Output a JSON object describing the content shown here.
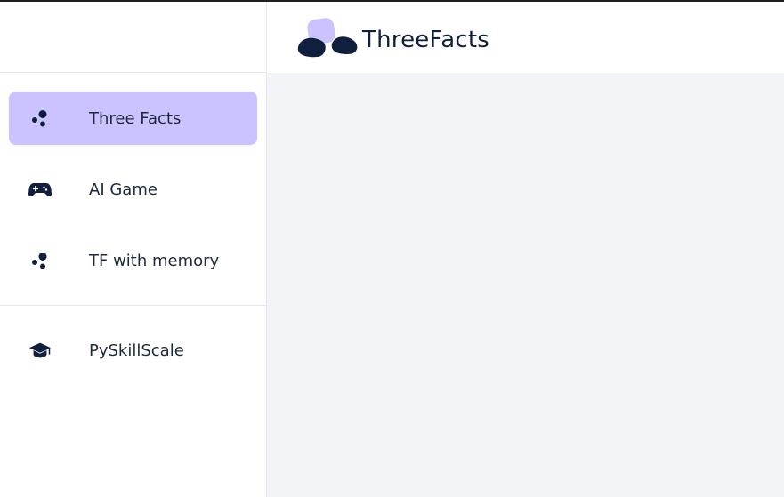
{
  "app": {
    "brand_name": "ThreeFacts",
    "accent_color": "#cbc3ff",
    "dark_color": "#0f1f3d"
  },
  "sidebar": {
    "items": [
      {
        "label": "Three Facts",
        "icon": "dots-icon",
        "active": true
      },
      {
        "label": "AI Game",
        "icon": "gamepad-icon",
        "active": false
      },
      {
        "label": "TF with memory",
        "icon": "dots-icon",
        "active": false
      }
    ],
    "secondary_items": [
      {
        "label": "PySkillScale",
        "icon": "graduation-cap-icon",
        "active": false
      }
    ]
  }
}
